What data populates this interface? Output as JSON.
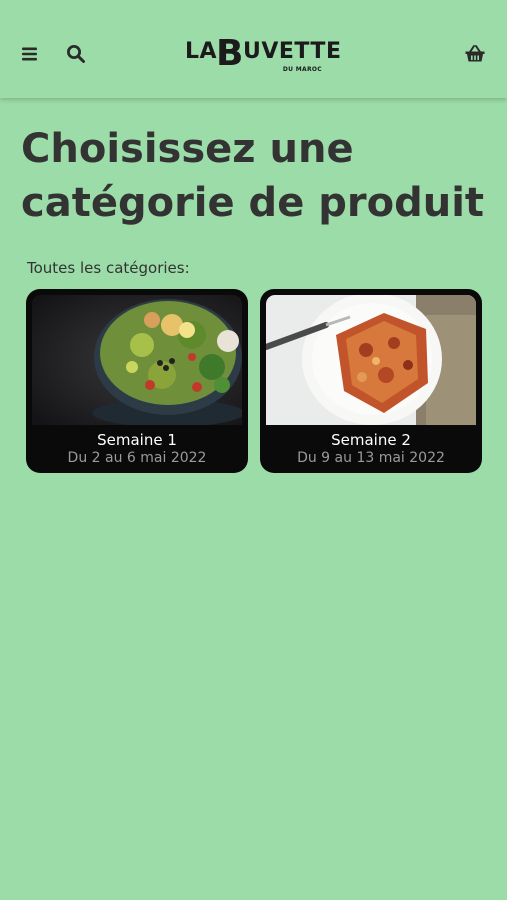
{
  "header": {
    "logo_text_la": "LA",
    "logo_text_b": "B",
    "logo_text_uvette": "UVETTE",
    "logo_subtitle": "DU MAROC",
    "icons": [
      "menu-icon",
      "search-icon",
      "basket-icon"
    ]
  },
  "main": {
    "title": "Choisissez une catégorie de produit",
    "section_label": "Toutes les catégories:",
    "categories": [
      {
        "title": "Semaine 1",
        "dates": "Du 2 au 6 mai 2022",
        "image": "salad-bowl"
      },
      {
        "title": "Semaine 2",
        "dates": "Du 9 au 13 mai 2022",
        "image": "lasagna-plate"
      }
    ]
  },
  "colors": {
    "background": "#9cdca8",
    "text": "#333333",
    "card": "#0a0a0a",
    "card_subtext": "#9a9a9a"
  }
}
